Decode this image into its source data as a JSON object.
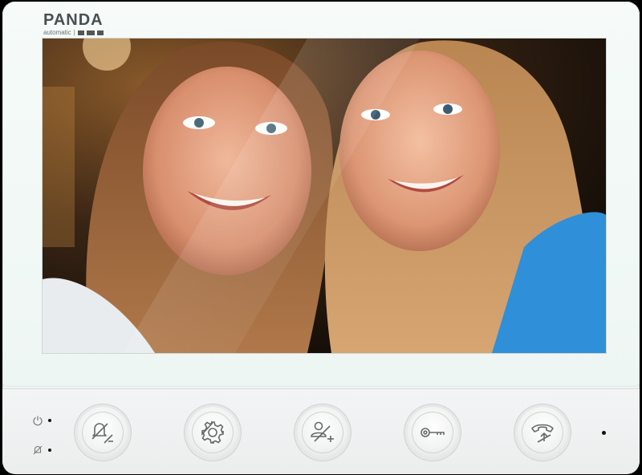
{
  "brand": {
    "name": "PANDA",
    "tagline": "automatic"
  },
  "screen": {
    "content": "video feed: two smiling people"
  },
  "status_indicators": [
    {
      "icon": "power-icon"
    },
    {
      "icon": "mute-bell-icon"
    }
  ],
  "buttons": [
    {
      "icon": "mute-volume-down-icon"
    },
    {
      "icon": "gear-icon"
    },
    {
      "icon": "user-add-icon"
    },
    {
      "icon": "key-icon"
    },
    {
      "icon": "phone-hangup-icon"
    }
  ],
  "colors": {
    "body": "#f4f8f6",
    "bezel": "#eef3f1",
    "icon_stroke": "#666a6b"
  }
}
